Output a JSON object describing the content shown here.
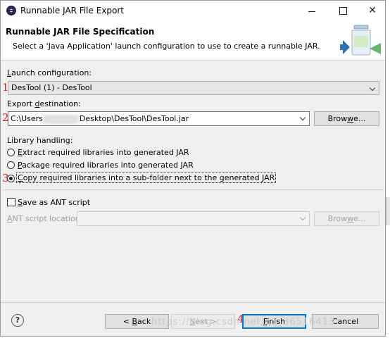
{
  "window": {
    "title": "Runnable JAR File Export"
  },
  "header": {
    "title": "Runnable JAR File Specification",
    "description": "Select a 'Java Application' launch configuration to use to create a runnable JAR."
  },
  "launch": {
    "label": "Launch configuration:",
    "value": "DesTool (1) - DesTool"
  },
  "export": {
    "label": "Export destination:",
    "value_prefix": "C:\\Users",
    "value_suffix": "Desktop\\DesTool\\DesTool.jar",
    "browse_label": "Browse..."
  },
  "library": {
    "label": "Library handling:",
    "options": [
      {
        "label": "Extract required libraries into generated JAR",
        "selected": false
      },
      {
        "label": "Package required libraries into generated JAR",
        "selected": false
      },
      {
        "label": "Copy required libraries into a sub-folder next to the generated JAR",
        "selected": true
      }
    ]
  },
  "ant": {
    "checkbox_label": "Save as ANT script",
    "location_label": "ANT script location:",
    "browse_label": "Browse..."
  },
  "footer": {
    "help_label": "?",
    "back_label": "< Back",
    "next_label": "Next >",
    "finish_label": "Finish",
    "cancel_label": "Cancel"
  },
  "annotations": {
    "marker_1": "1",
    "marker_2": "2",
    "marker_3": "3",
    "marker_4": "4"
  },
  "watermark": "https://blog.csdn.net/qq_36516413",
  "colors": {
    "annotation": "#e0201c",
    "default_button_border": "#0078d7",
    "dialog_background": "#f0f0f0"
  }
}
